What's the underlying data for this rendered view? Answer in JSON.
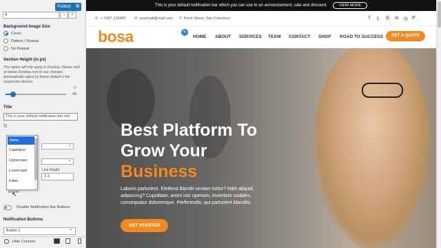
{
  "sidebar": {
    "publish_label": "Publish",
    "number_value": "4",
    "bg_image_size": {
      "label": "Background Image Size",
      "options": [
        "Cover",
        "Pattern / Repeat",
        "No Repeat"
      ],
      "selected": "Cover"
    },
    "section_height": {
      "label": "Section Height (in px)",
      "description": "This option will only apply to Desktop. Please click on below Desktop Icon to see changes. Automatically adjust by theme default in the responsive devices.",
      "value": "40",
      "slider_fraction": 0.12
    },
    "title": {
      "label": "Title",
      "value": "This is your default notification bar whi"
    },
    "ghost_label": "Ti",
    "transform_dropdown": {
      "options": [
        "None",
        "Capitalize",
        "Uppercase",
        "Lowercase",
        "Initial",
        "Inherit"
      ],
      "selected": "None"
    },
    "line_height": {
      "label": "Line Height",
      "value": "1.3"
    },
    "disable_buttons_label": "Disable Notification Bar Buttons",
    "notification_buttons": {
      "label": "Notification Buttons",
      "selected": "Button 1"
    },
    "hide_controls_label": "Hide Controls"
  },
  "site": {
    "notice": {
      "text": "This is your default notification bar which you can use to an announcement, sale and discount.",
      "button": "VIEW MORE"
    },
    "contact": {
      "phone": "+ 1987 123456",
      "email": "yourmail@mail.com",
      "address": "Rock Street, San Francisco"
    },
    "social_icons": [
      "facebook-icon",
      "twitter-icon",
      "google-icon",
      "linkedin-icon",
      "instagram-icon",
      "pinterest-icon"
    ],
    "logo": "bosa",
    "nav": [
      "HOME",
      "ABOUT",
      "SERVICES",
      "TEAM",
      "CONTACT",
      "SHOP",
      "ROAD TO SUCCESS"
    ],
    "quote_button": "GET A QUOTE",
    "hero": {
      "line1": "Best Platform To",
      "line2": "Grow Your",
      "line3": "Business",
      "text": "Laboris parturient. Eleifend blandit veniam tortor? Nibh aliquid, adipiscing? Cupiditate, animi iste operiam, inventore sodales, consequatur doloremque. Perferendis, qui parturient blandits.",
      "button": "GET STARTED"
    },
    "colors": {
      "accent": "#f08a24",
      "wp_blue": "#2271b1"
    }
  }
}
